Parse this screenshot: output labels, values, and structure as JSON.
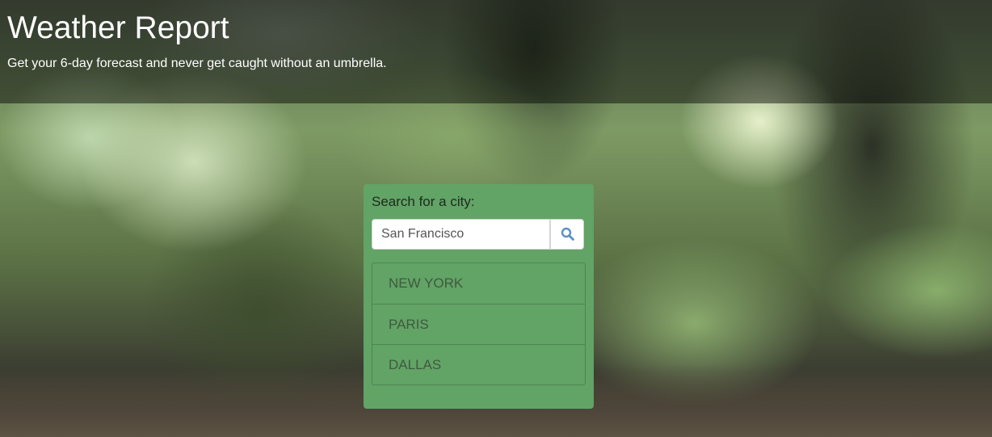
{
  "header": {
    "title": "Weather Report",
    "subtitle": "Get your 6-day forecast and never get caught without an umbrella."
  },
  "search": {
    "label": "Search for a city:",
    "value": "San Francisco",
    "button_icon": "search-icon"
  },
  "cities": [
    {
      "label": "NEW YORK"
    },
    {
      "label": "PARIS"
    },
    {
      "label": "DALLAS"
    }
  ],
  "colors": {
    "panel": "#62a366",
    "header_overlay": "rgba(0,0,0,0.45)",
    "icon_accent": "#5b8fc7"
  }
}
